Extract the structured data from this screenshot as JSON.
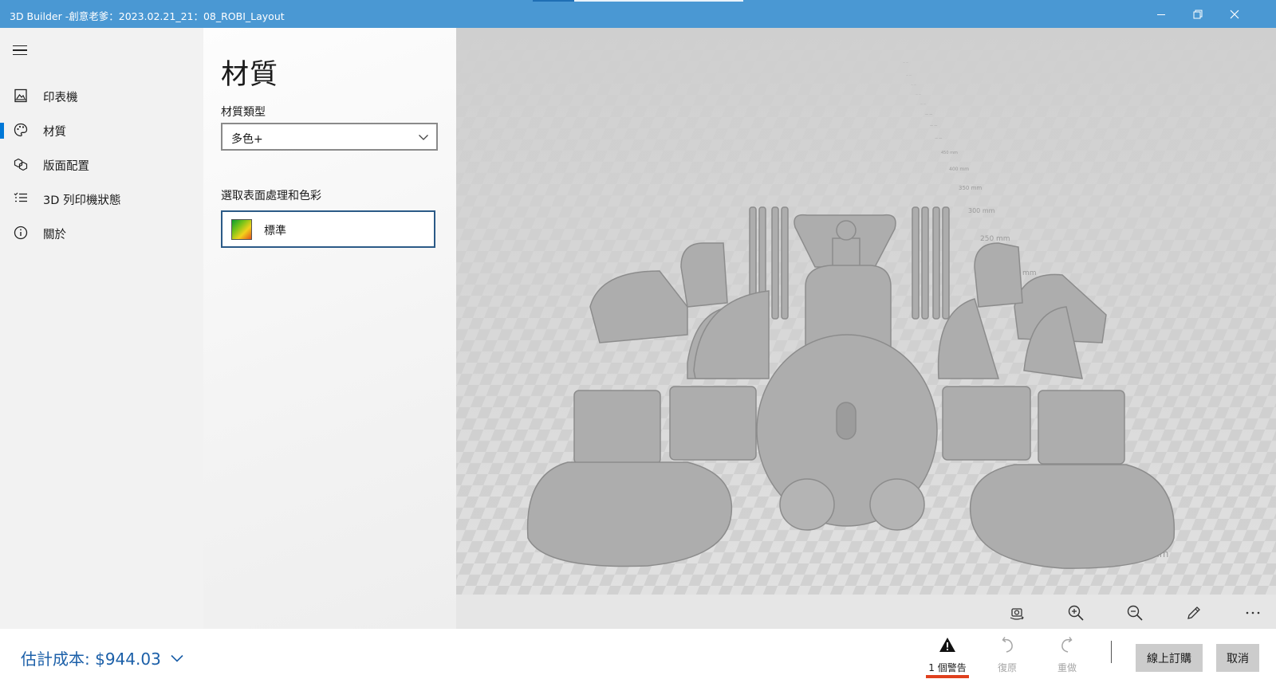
{
  "window": {
    "title": "3D Builder -創意老爹：2023.02.21_21：08_ROBI_Layout",
    "controls": [
      "minimize",
      "restore",
      "close"
    ]
  },
  "nav": {
    "menu_icon": "hamburger-menu-icon",
    "items": [
      {
        "label": "印表機",
        "icon": "printer-icon",
        "selected": false
      },
      {
        "label": "材質",
        "icon": "palette-icon",
        "selected": true
      },
      {
        "label": "版面配置",
        "icon": "layout-icon",
        "selected": false
      },
      {
        "label": "3D 列印機狀態",
        "icon": "list-status-icon",
        "selected": false
      },
      {
        "label": "關於",
        "icon": "info-icon",
        "selected": false
      }
    ]
  },
  "panel": {
    "title": "材質",
    "material_type_label": "材質類型",
    "material_type_value": "多色+",
    "finish_label": "選取表面處理和色彩",
    "finish_value": "標準"
  },
  "viewport": {
    "ruler_labels": [
      "250 mm",
      "300 mm",
      "350 mm",
      "400 mm",
      "450 mm"
    ],
    "model_color": "#a9a9a9",
    "floor_color": "#d9d9d9"
  },
  "view_tools": [
    "camera-orbit-icon",
    "zoom-in-icon",
    "zoom-out-icon",
    "pencil-icon",
    "more-icon"
  ],
  "bottom": {
    "cost_label": "估計成本: $944.03",
    "warning_label": "1 個警告",
    "undo_label": "復原",
    "redo_label": "重做",
    "order_label": "線上訂購",
    "cancel_label": "取消"
  },
  "colors": {
    "accent": "#0078d7",
    "titlebar": "#4a98d3",
    "cost_text": "#1b5fa8",
    "warning_underline": "#e0401d"
  }
}
